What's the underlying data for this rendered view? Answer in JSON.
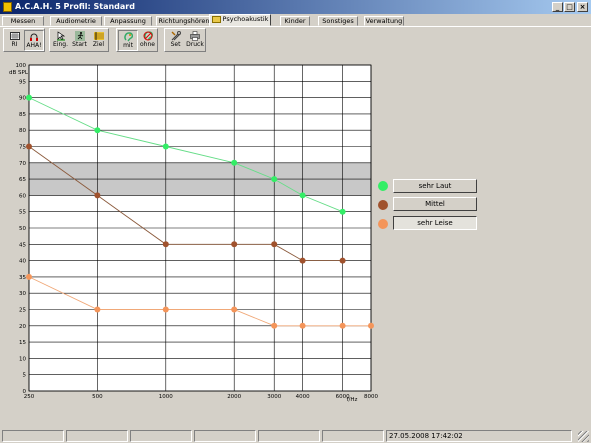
{
  "window": {
    "title": "A.C.A.H. 5  Profil: Standard"
  },
  "tabs": [
    {
      "label": "Messen",
      "active": false
    },
    {
      "label": "Audiometrie",
      "active": false
    },
    {
      "label": "Anpassung",
      "active": false
    },
    {
      "label": "Richtungshören",
      "active": false
    },
    {
      "label": "Psychoakustik",
      "active": true
    },
    {
      "label": "Kinder",
      "active": false
    },
    {
      "label": "Sonstiges",
      "active": false
    },
    {
      "label": "Verwaltung",
      "active": false
    }
  ],
  "toolbar": {
    "ri": {
      "label": "RI",
      "icon": "grid-icon"
    },
    "aha": {
      "label": "AHA!",
      "icon": "headphones-icon"
    },
    "eing": {
      "label": "Eing.",
      "icon": "cursor-icon"
    },
    "start": {
      "label": "Start",
      "icon": "running-man-icon"
    },
    "ziel": {
      "label": "Ziel",
      "icon": "finish-icon"
    },
    "mit": {
      "label": "mit",
      "icon": "ear-icon"
    },
    "ohne": {
      "label": "ohne",
      "icon": "no-ear-icon"
    },
    "set": {
      "label": "Set",
      "icon": "tools-icon"
    },
    "druck": {
      "label": "Druck",
      "icon": "printer-icon"
    }
  },
  "legend": [
    {
      "label": "sehr Laut",
      "color": "#33ee66",
      "active": false
    },
    {
      "label": "Mittel",
      "color": "#a0522d",
      "active": false
    },
    {
      "label": "sehr Leise",
      "color": "#f4955a",
      "active": true
    }
  ],
  "status": {
    "datetime": "27.05.2008 17:42:02"
  },
  "chart_data": {
    "type": "line",
    "ylabel": "dB SPL",
    "xlabel": "f/Hz",
    "x": [
      250,
      500,
      1000,
      2000,
      3000,
      4000,
      6000,
      8000
    ],
    "x_ticks": [
      "250",
      "500",
      "1000",
      "2000",
      "3000",
      "4000",
      "6000",
      "8000"
    ],
    "y_ticks": [
      "0",
      "5",
      "10",
      "15",
      "20",
      "25",
      "30",
      "35",
      "40",
      "45",
      "50",
      "55",
      "60",
      "65",
      "70",
      "75",
      "80",
      "85",
      "90",
      "95",
      "100"
    ],
    "ylim": [
      0,
      100
    ],
    "x_scale": "log",
    "grid": true,
    "shaded_band": [
      60,
      70
    ],
    "series": [
      {
        "values": [
          90,
          80,
          75,
          70,
          65,
          60,
          55,
          null
        ],
        "color": "#33ee66",
        "line_color": "#66dd88"
      },
      {
        "values": [
          75,
          60,
          45,
          45,
          45,
          40,
          40,
          null
        ],
        "color": "#a0522d",
        "line_color": "#8b5a3c"
      },
      {
        "values": [
          35,
          25,
          25,
          25,
          20,
          20,
          20,
          20
        ],
        "color": "#f4955a",
        "line_color": "#f0a878"
      }
    ]
  }
}
